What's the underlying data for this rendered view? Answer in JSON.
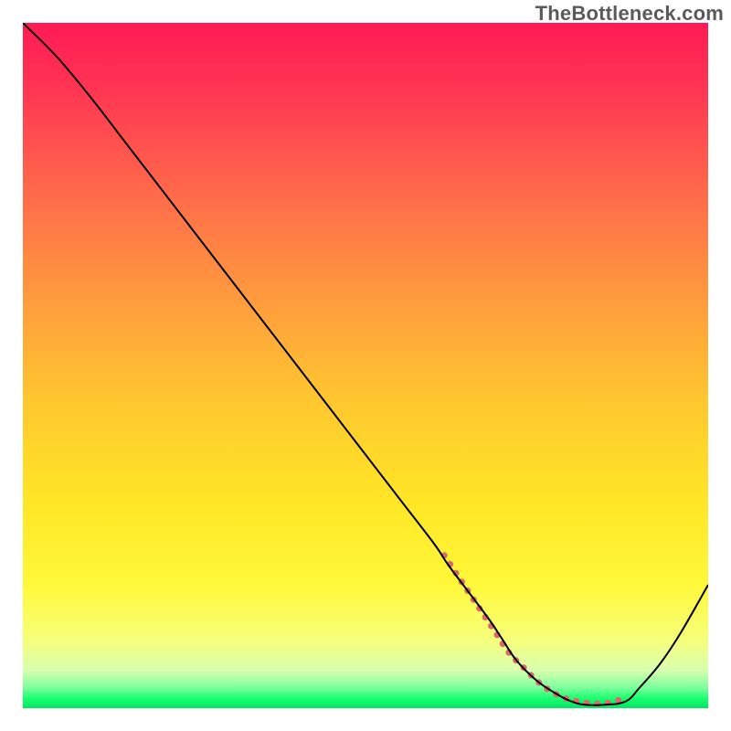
{
  "watermark": "TheBottleneck.com",
  "chart_data": {
    "type": "line",
    "title": "",
    "xlabel": "",
    "ylabel": "",
    "xlim": [
      0,
      100
    ],
    "ylim": [
      0,
      100
    ],
    "grid": false,
    "legend": false,
    "series": [
      {
        "name": "curve",
        "x": [
          0,
          5,
          10,
          15,
          20,
          25,
          30,
          35,
          40,
          45,
          50,
          55,
          60,
          62,
          65,
          68,
          70,
          72,
          75,
          78,
          80,
          82,
          85,
          88,
          90,
          93,
          96,
          100
        ],
        "y": [
          100,
          95,
          89,
          82.5,
          76,
          69.5,
          63,
          56.5,
          50,
          43.5,
          37,
          30.5,
          24,
          21,
          17,
          13,
          10,
          7,
          4,
          2,
          1,
          0.5,
          0.5,
          1,
          3,
          6.5,
          11,
          18
        ]
      },
      {
        "name": "highlight",
        "x": [
          61.5,
          63,
          65,
          67,
          69,
          71,
          73,
          75,
          77,
          79,
          81,
          83,
          85,
          87
        ],
        "y": [
          22.3,
          20,
          17,
          14,
          11,
          8,
          6,
          4,
          2.5,
          1.5,
          1,
          0.7,
          0.7,
          1.2
        ]
      }
    ],
    "gradient_stops": [
      {
        "offset": 0.0,
        "color": "#ff1a55"
      },
      {
        "offset": 0.1,
        "color": "#ff3652"
      },
      {
        "offset": 0.25,
        "color": "#ff6b4a"
      },
      {
        "offset": 0.4,
        "color": "#ff9a3e"
      },
      {
        "offset": 0.55,
        "color": "#ffc72f"
      },
      {
        "offset": 0.7,
        "color": "#ffe626"
      },
      {
        "offset": 0.82,
        "color": "#fff83a"
      },
      {
        "offset": 0.9,
        "color": "#f6ff7a"
      },
      {
        "offset": 0.945,
        "color": "#d8ffb0"
      },
      {
        "offset": 0.97,
        "color": "#7cff9c"
      },
      {
        "offset": 0.985,
        "color": "#1dff72"
      },
      {
        "offset": 1.0,
        "color": "#00e45f"
      }
    ],
    "styles": {
      "curve_stroke": "#000",
      "curve_width": 2,
      "highlight_stroke": "#d86a6a",
      "highlight_width": 7,
      "highlight_linecap": "round",
      "highlight_dasharray": "0.1 11.5"
    }
  }
}
